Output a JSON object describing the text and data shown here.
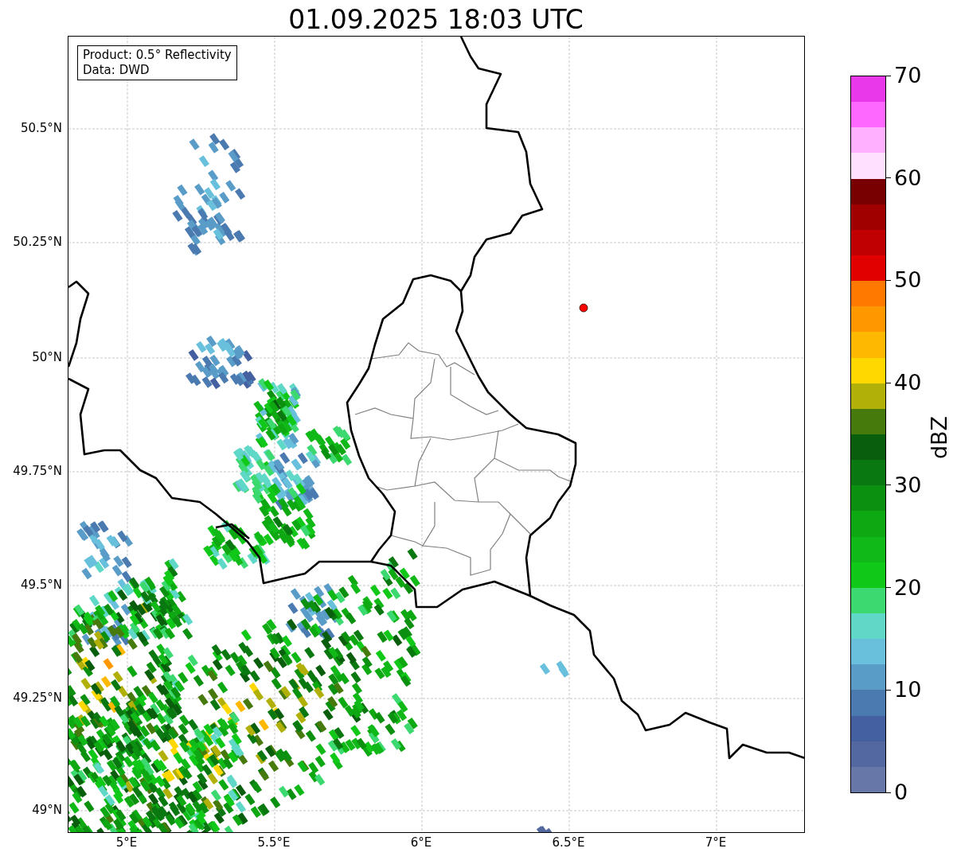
{
  "title": "01.09.2025 18:03 UTC",
  "info_box": [
    "Product: 0.5° Reflectivity",
    "Data: DWD"
  ],
  "map": {
    "lat_labels": [
      "50.5°N",
      "50.25°N",
      "50°N",
      "49.75°N",
      "49.5°N",
      "49.25°N",
      "49°N"
    ],
    "lon_labels": [
      "5°E",
      "5.5°E",
      "6°E",
      "6.5°E",
      "7°E"
    ]
  },
  "colorbar": {
    "label": "dBZ",
    "ticks": [
      "70",
      "60",
      "50",
      "40",
      "30",
      "20",
      "10",
      "0"
    ],
    "bands": [
      {
        "color": "#6677a8"
      },
      {
        "color": "#5468a0"
      },
      {
        "color": "#4460a0"
      },
      {
        "color": "#4a7ab0"
      },
      {
        "color": "#5a9cc8"
      },
      {
        "color": "#68c0dc"
      },
      {
        "color": "#60d8c8"
      },
      {
        "color": "#3cd870"
      },
      {
        "color": "#10c818"
      },
      {
        "color": "#10b818"
      },
      {
        "color": "#0ea812"
      },
      {
        "color": "#0c9010"
      },
      {
        "color": "#0a7810"
      },
      {
        "color": "#085e0c"
      },
      {
        "color": "#467a0c"
      },
      {
        "color": "#b0b008"
      },
      {
        "color": "#ffd800"
      },
      {
        "color": "#ffb800"
      },
      {
        "color": "#ff9800"
      },
      {
        "color": "#ff7800"
      },
      {
        "color": "#e00000"
      },
      {
        "color": "#c00000"
      },
      {
        "color": "#a00000"
      },
      {
        "color": "#780000"
      },
      {
        "color": "#ffe0ff"
      },
      {
        "color": "#ffb0ff"
      },
      {
        "color": "#ff68ff"
      },
      {
        "color": "#e838e8"
      }
    ]
  }
}
